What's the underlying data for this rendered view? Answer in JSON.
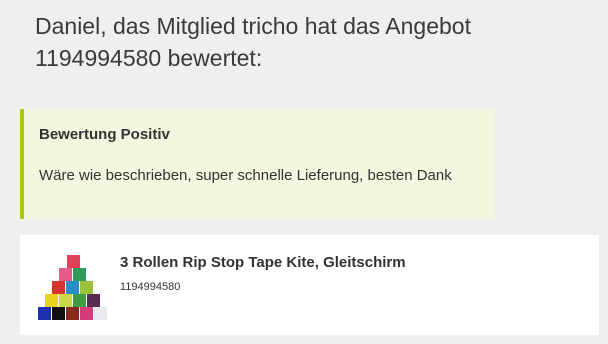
{
  "headline": "Daniel, das Mitglied tricho hat das Angebot 1194994580 bewertet:",
  "review": {
    "title": "Bewertung Positiv",
    "text": "Wäre wie beschrieben, super schnelle Lieferung, besten Dank"
  },
  "product": {
    "title": "3 Rollen Rip Stop Tape Kite, Gleitschirm",
    "id": "1194994580",
    "image_icon": "tape-rolls-pyramid"
  },
  "colors": {
    "background": "#efefed",
    "review_bg": "#f4f6df",
    "accent_green": "#a9c41c",
    "card_bg": "#ffffff"
  }
}
